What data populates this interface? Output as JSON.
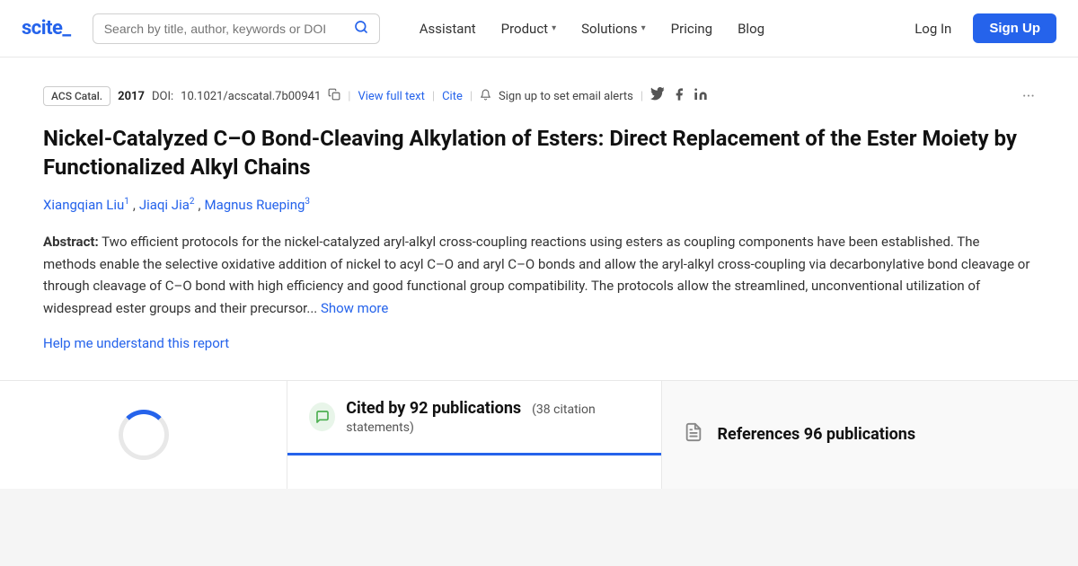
{
  "brand": {
    "name": "scite_",
    "logo_text": "scite",
    "logo_suffix": "_"
  },
  "navbar": {
    "search_placeholder": "Search by title, author, keywords or DOI",
    "links": [
      {
        "label": "Assistant",
        "has_dropdown": false
      },
      {
        "label": "Product",
        "has_dropdown": true
      },
      {
        "label": "Solutions",
        "has_dropdown": true
      },
      {
        "label": "Pricing",
        "has_dropdown": false
      },
      {
        "label": "Blog",
        "has_dropdown": false
      }
    ],
    "login_label": "Log In",
    "signup_label": "Sign Up"
  },
  "article": {
    "journal": "ACS Catal.",
    "year": "2017",
    "doi_label": "DOI:",
    "doi": "10.1021/acscatal.7b00941",
    "view_full_text": "View full text",
    "cite": "Cite",
    "alert_text": "Sign up to set email alerts",
    "title": "Nickel-Catalyzed C–O Bond-Cleaving Alkylation of Esters: Direct Replacement of the Ester Moiety by Functionalized Alkyl Chains",
    "authors": [
      {
        "name": "Xiangqian Liu",
        "superscript": "1"
      },
      {
        "name": "Jiaqi Jia",
        "superscript": "2"
      },
      {
        "name": "Magnus Rueping",
        "superscript": "3"
      }
    ],
    "abstract_label": "Abstract:",
    "abstract_text": "Two efficient protocols for the nickel-catalyzed aryl-alkyl cross-coupling reactions using esters as coupling components have been established. The methods enable the selective oxidative addition of nickel to acyl C–O and aryl C–O bonds and allow the aryl-alkyl cross-coupling via decarbonylative bond cleavage or through cleavage of C–O bond with high efficiency and good functional group compatibility. The protocols allow the streamlined, unconventional utilization of widespread ester groups and their precursor...",
    "show_more": "Show more",
    "help_link": "Help me understand this report"
  },
  "stats": {
    "cited_by_label": "Cited by 92 publications",
    "cited_by_count": "92",
    "citation_statements": "(38 citation statements)",
    "references_label": "References 96 publications",
    "references_count": "96"
  }
}
